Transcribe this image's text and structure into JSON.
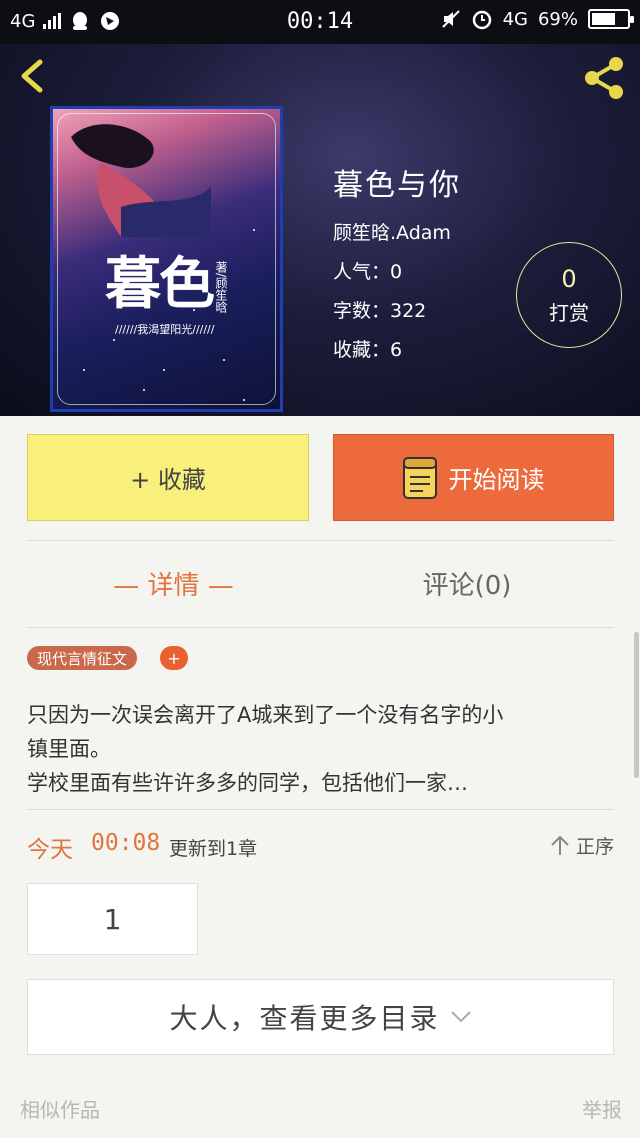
{
  "status_bar": {
    "network": "4G",
    "time": "00:14",
    "network_right": "4G",
    "battery": "69%",
    "battery_level": 0.69,
    "icons": [
      "signal-icon",
      "qq-icon",
      "browser-icon",
      "mute-icon",
      "alarm-icon",
      "battery-icon"
    ]
  },
  "header": {
    "back_icon": "chevron-left-icon",
    "share_icon": "share-icon",
    "accent_color": "#e6d84a"
  },
  "book": {
    "cover_title": "暮色",
    "cover_author_mark": "著",
    "cover_author_name": "顾笙晗",
    "cover_subtitle": "//////我渴望阳光//////",
    "title": "暮色与你",
    "author": "顾笙晗.Adam",
    "popularity": "人气：0",
    "word_count": "字数：322",
    "favorites": "收藏：6"
  },
  "tip": {
    "count": "0",
    "label": "打赏"
  },
  "actions": {
    "collect_label": "+ 收藏",
    "read_label": "开始阅读",
    "collect_color": "#f8f07a",
    "read_color": "#ec6a3c"
  },
  "tabs": [
    {
      "label": "— 详情 —",
      "active": true
    },
    {
      "label": "评论(0)",
      "active": false
    }
  ],
  "tag": {
    "label": "现代言情征文",
    "add_label": "+"
  },
  "description": {
    "line1": " 只因为一次误会离开了A城来到了一个没有名字的小",
    "line2": "镇里面。",
    "line3": "学校里面有些许许多多的同学，包括他们一家…"
  },
  "update": {
    "day": "今天",
    "time": "00:08",
    "text": "更新到1章",
    "sort_label": "正序"
  },
  "chapter_button": "1",
  "more_button": "大人，查看更多目录",
  "footer": {
    "similar": "相似作品",
    "report": "举报"
  }
}
